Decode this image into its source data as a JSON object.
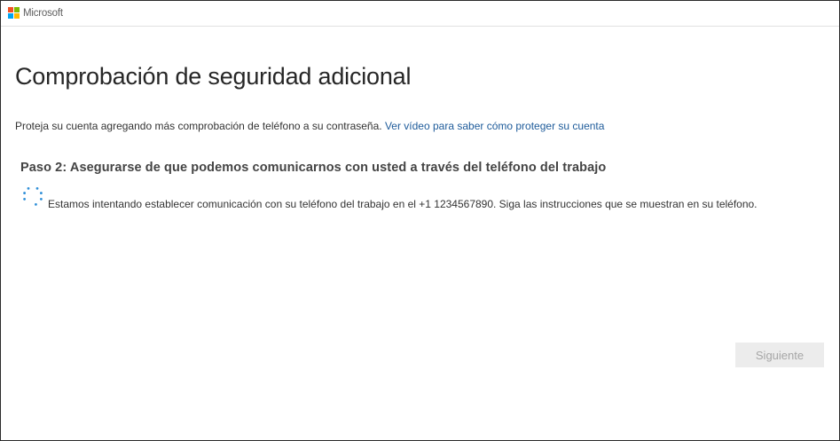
{
  "brand": {
    "name": "Microsoft",
    "logo_colors": [
      "#f25022",
      "#7fba00",
      "#00a4ef",
      "#ffb900"
    ]
  },
  "page": {
    "title": "Comprobación de seguridad adicional",
    "intro_text": "Proteja su cuenta agregando más comprobación de teléfono a su contraseña.",
    "intro_link": "Ver vídeo para saber cómo proteger su cuenta"
  },
  "step": {
    "heading": "Paso 2: Asegurarse de que podemos comunicarnos con usted a través del teléfono del trabajo",
    "status_text": "Estamos intentando establecer comunicación con su teléfono del trabajo en el +1 1234567890. Siga las instrucciones que se muestran en su teléfono.",
    "spinner_icon": "loading-spinner-icon",
    "spinner_color": "#2f8fd8"
  },
  "actions": {
    "next_label": "Siguiente"
  }
}
